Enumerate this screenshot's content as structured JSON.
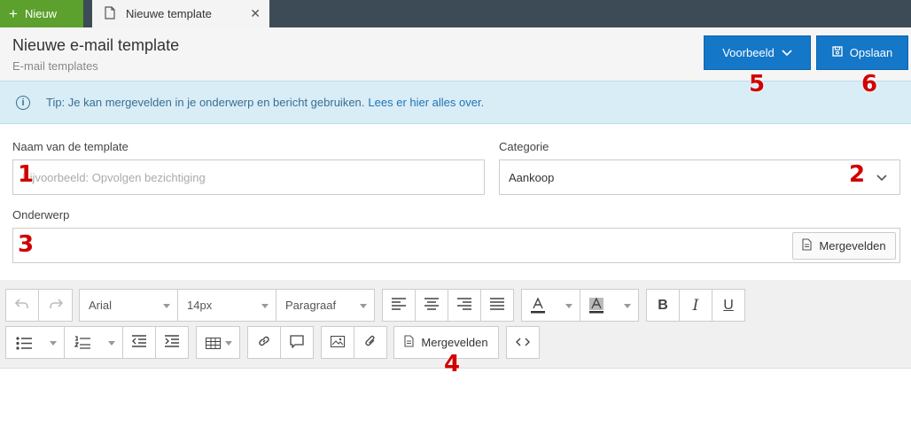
{
  "topbar": {
    "new_label": "Nieuw",
    "tab_label": "Nieuwe template"
  },
  "header": {
    "title": "Nieuwe e-mail template",
    "subtitle": "E-mail templates",
    "preview_label": "Voorbeeld",
    "save_label": "Opslaan"
  },
  "tip": {
    "text": "Tip: Je kan mergevelden in je onderwerp en bericht gebruiken.",
    "link": "Lees er hier alles over."
  },
  "form": {
    "name_label": "Naam van de template",
    "name_placeholder": "Bijvoorbeeld: Opvolgen bezichtiging",
    "category_label": "Categorie",
    "category_value": "Aankoop",
    "subject_label": "Onderwerp",
    "subject_value": "",
    "merge_label": "Mergevelden"
  },
  "toolbar": {
    "font": "Arial",
    "size": "14px",
    "block": "Paragraaf",
    "merge_label": "Mergevelden"
  },
  "annotations": [
    "1",
    "2",
    "3",
    "4",
    "5",
    "6"
  ],
  "colors": {
    "accent": "#1477c8",
    "new_green": "#5ca02d",
    "topbar": "#3d4b56",
    "tip_bg": "#d9edf7",
    "annotation": "#d10000"
  }
}
